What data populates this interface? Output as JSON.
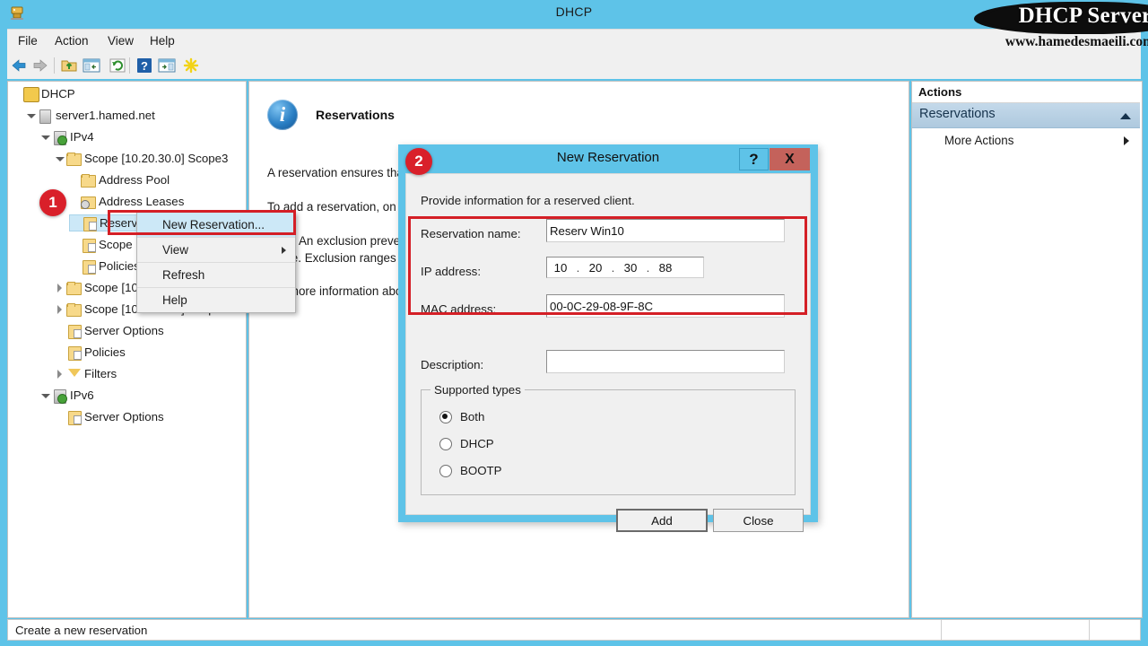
{
  "window": {
    "title": "DHCP",
    "app_icon": "dhcp-server-icon"
  },
  "watermark": {
    "title": "DHCP Server",
    "url": "www.hamedesmaeili.com"
  },
  "menubar": {
    "items": [
      {
        "label": "File"
      },
      {
        "label": "Action"
      },
      {
        "label": "View"
      },
      {
        "label": "Help"
      }
    ]
  },
  "toolbar": {
    "buttons": [
      {
        "name": "back-arrow-icon"
      },
      {
        "name": "forward-arrow-icon"
      },
      {
        "name": "up-folder-icon"
      },
      {
        "name": "show-hide-console-tree-icon"
      },
      {
        "name": "refresh-icon"
      },
      {
        "name": "help-icon"
      },
      {
        "name": "show-hide-action-pane-icon"
      },
      {
        "name": "new-item-icon"
      }
    ]
  },
  "tree": {
    "nodes": [
      {
        "label": "DHCP",
        "indent": 0,
        "expander": "none",
        "icon": "dhcp-root-icon",
        "selected": false
      },
      {
        "label": "server1.hamed.net",
        "indent": 1,
        "expander": "open",
        "icon": "server-icon",
        "selected": false
      },
      {
        "label": "IPv4",
        "indent": 2,
        "expander": "open",
        "icon": "ipv4-icon",
        "selected": false
      },
      {
        "label": "Scope [10.20.30.0] Scope3",
        "indent": 3,
        "expander": "open",
        "icon": "folder-icon",
        "selected": false
      },
      {
        "label": "Address Pool",
        "indent": 4,
        "expander": "none",
        "icon": "address-pool-icon",
        "selected": false
      },
      {
        "label": "Address Leases",
        "indent": 4,
        "expander": "none",
        "icon": "address-leases-icon",
        "selected": false
      },
      {
        "label": "Reservations",
        "indent": 4,
        "expander": "none",
        "icon": "reservations-icon",
        "selected": true
      },
      {
        "label": "Scope Options",
        "indent": 4,
        "expander": "none",
        "icon": "scope-options-icon",
        "selected": false
      },
      {
        "label": "Policies",
        "indent": 4,
        "expander": "none",
        "icon": "policies-icon",
        "selected": false
      },
      {
        "label": "Scope [10.20.10.0] Scope1",
        "indent": 3,
        "expander": "closed",
        "icon": "folder-icon",
        "selected": false
      },
      {
        "label": "Scope [10.20.20.0] Scope2",
        "indent": 3,
        "expander": "closed",
        "icon": "folder-icon",
        "selected": false
      },
      {
        "label": "Server Options",
        "indent": 3,
        "expander": "none",
        "icon": "server-options-icon",
        "selected": false
      },
      {
        "label": "Policies",
        "indent": 3,
        "expander": "none",
        "icon": "policies-icon",
        "selected": false
      },
      {
        "label": "Filters",
        "indent": 3,
        "expander": "closed",
        "icon": "filters-icon",
        "selected": false
      },
      {
        "label": "IPv6",
        "indent": 2,
        "expander": "open",
        "icon": "ipv6-icon",
        "selected": false
      },
      {
        "label": "Server Options",
        "indent": 3,
        "expander": "none",
        "icon": "server-options-icon",
        "selected": false
      }
    ]
  },
  "context_menu": {
    "items": [
      {
        "label": "New Reservation...",
        "highlighted": true,
        "submenu": false
      },
      {
        "label": "View",
        "highlighted": false,
        "submenu": true
      },
      {
        "label": "Refresh",
        "highlighted": false,
        "submenu": false
      },
      {
        "label": "Help",
        "highlighted": false,
        "submenu": false
      }
    ]
  },
  "detail": {
    "heading": "Reservations",
    "info_icon": "i",
    "paragraph1": "A reservation ensures that a DHCP client is always assigned the same IP address.",
    "paragraph2": "To add a reservation, on the Action menu, click New Reservation.",
    "paragraph3_a": "Note: An exclusion prevents the DHCP server from assigning the excluded address",
    "paragraph3_b": "range. Exclusion ranges are not leased to clients.",
    "paragraph4": "For more information about setting up a reservation, see online Help."
  },
  "actions": {
    "header": "Actions",
    "section_label": "Reservations",
    "items": [
      {
        "label": "More Actions",
        "submenu": true
      }
    ]
  },
  "statusbar": {
    "text": "Create a new reservation"
  },
  "dialog": {
    "title": "New Reservation",
    "help_button": "?",
    "close_button": "X",
    "intro": "Provide information for a reserved client.",
    "fields": [
      {
        "label": "Reservation name:",
        "value": "Reserv Win10",
        "placeholder": ""
      },
      {
        "label": "IP address:",
        "value": "10.20.30.88",
        "placeholder": ""
      },
      {
        "label": "MAC address:",
        "value": "00-0C-29-08-9F-8C",
        "placeholder": ""
      },
      {
        "label": "Description:",
        "value": "",
        "placeholder": ""
      }
    ],
    "ip_octets": [
      "10",
      "20",
      "30",
      "88"
    ],
    "group": {
      "title": "Supported types",
      "options": [
        {
          "label": "Both",
          "selected": true
        },
        {
          "label": "DHCP",
          "selected": false
        },
        {
          "label": "BOOTP",
          "selected": false
        }
      ]
    },
    "buttons": {
      "add": "Add",
      "close": "Close"
    }
  },
  "badges": [
    {
      "number": "1"
    },
    {
      "number": "2"
    }
  ],
  "colors": {
    "window_chrome": "#5ec3e8",
    "accent_red": "#d41f26",
    "badge_red": "#d9202a",
    "selection_blue": "#cce8f7",
    "close_button_red": "#c4625b"
  }
}
